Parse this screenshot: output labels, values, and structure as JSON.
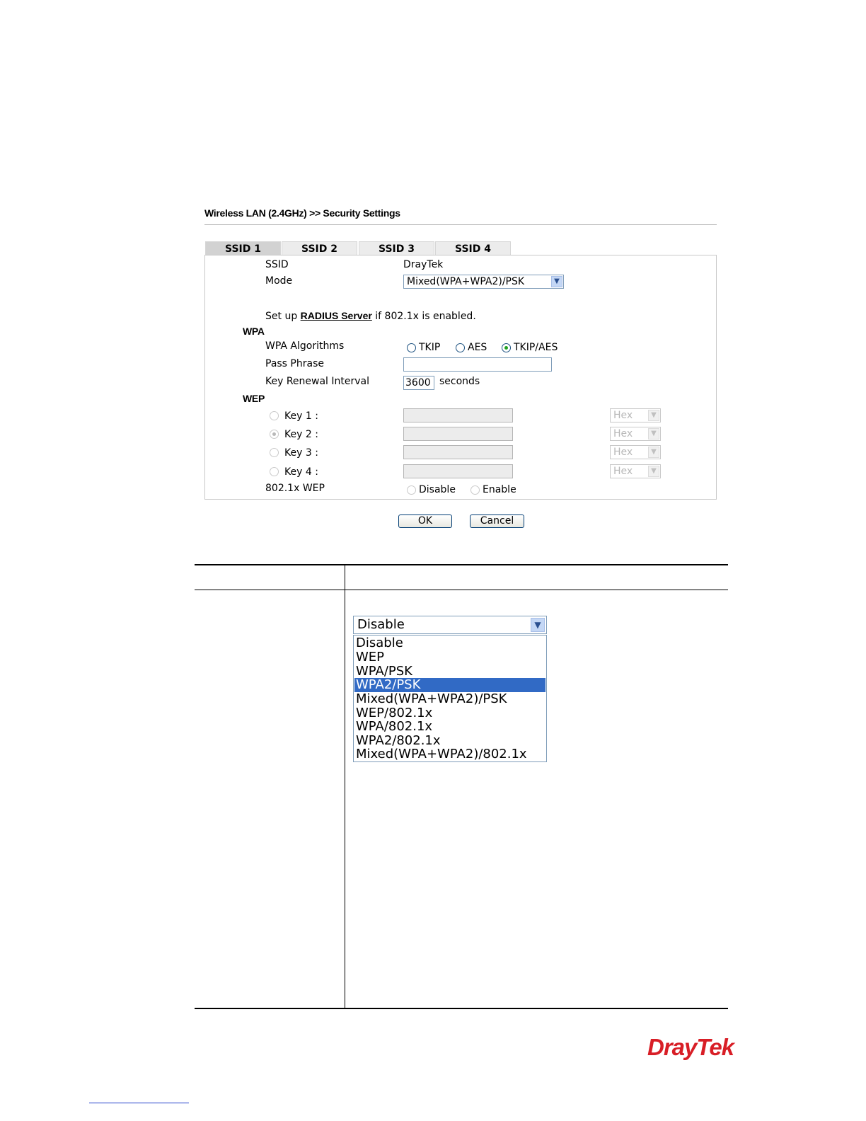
{
  "header": {
    "title": "Wireless LAN (2.4GHz) >> Security Settings"
  },
  "tabs": [
    {
      "label": "SSID 1",
      "active": true
    },
    {
      "label": "SSID 2",
      "active": false
    },
    {
      "label": "SSID 3",
      "active": false
    },
    {
      "label": "SSID 4",
      "active": false
    }
  ],
  "form": {
    "ssid_label": "SSID",
    "ssid_value": "DrayTek",
    "mode_label": "Mode",
    "mode_value": "Mixed(WPA+WPA2)/PSK",
    "radius_prefix": "Set up ",
    "radius_link": "RADIUS Server",
    "radius_suffix": " if 802.1x is enabled.",
    "wpa": {
      "heading": "WPA",
      "algorithms_label": "WPA Algorithms",
      "algorithms": [
        {
          "label": "TKIP",
          "checked": false
        },
        {
          "label": "AES",
          "checked": false
        },
        {
          "label": "TKIP/AES",
          "checked": true
        }
      ],
      "pass_phrase_label": "Pass Phrase",
      "pass_phrase_value": "",
      "key_renewal_label": "Key Renewal Interval",
      "key_renewal_value": "3600",
      "key_renewal_unit": "seconds"
    },
    "wep": {
      "heading": "WEP",
      "keys": [
        {
          "label": "Key 1 :",
          "checked": false,
          "format": "Hex"
        },
        {
          "label": "Key 2 :",
          "checked": true,
          "format": "Hex"
        },
        {
          "label": "Key 3 :",
          "checked": false,
          "format": "Hex"
        },
        {
          "label": "Key 4 :",
          "checked": false,
          "format": "Hex"
        }
      ],
      "dot1x_label": "802.1x WEP",
      "dot1x_options": [
        {
          "label": "Disable",
          "checked": false
        },
        {
          "label": "Enable",
          "checked": false
        }
      ]
    },
    "buttons": {
      "ok": "OK",
      "cancel": "Cancel"
    }
  },
  "mode_dropdown": {
    "current": "Disable",
    "options": [
      "Disable",
      "WEP",
      "WPA/PSK",
      "WPA2/PSK",
      "Mixed(WPA+WPA2)/PSK",
      "WEP/802.1x",
      "WPA/802.1x",
      "WPA2/802.1x",
      "Mixed(WPA+WPA2)/802.1x"
    ],
    "highlighted": "WPA2/PSK"
  },
  "brand": {
    "logo_text": "DrayTek",
    "color": "#d81e26"
  },
  "colors": {
    "tab_active": "#d2d2d2",
    "tab_inactive": "#ececec",
    "selection": "#316ac5",
    "radio_dot": "#21a121"
  }
}
